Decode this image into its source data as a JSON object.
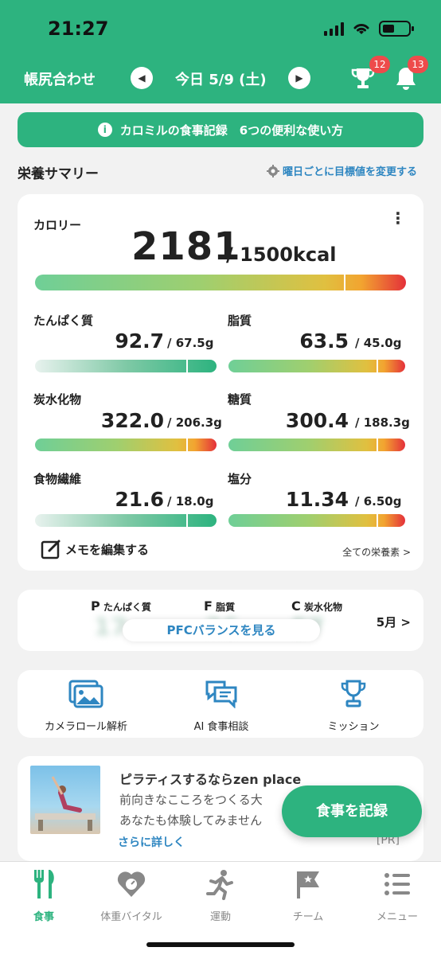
{
  "status": {
    "time": "21:27"
  },
  "header": {
    "left_label": "帳尻合わせ",
    "date": "今日 5/9 (土)",
    "trophy_badge": "12",
    "bell_badge": "13"
  },
  "banner": {
    "text": "カロミルの食事記録　6つの便利な使い方"
  },
  "summary": {
    "title": "栄養サマリー",
    "link": "曜日ごとに目標値を変更する"
  },
  "calories": {
    "label": "カロリー",
    "value": "2181",
    "target": "/ 1500kcal",
    "progress": 1.454
  },
  "nutrients": [
    {
      "name": "たんぱく質",
      "value": "92.7",
      "target": "/ 67.5g",
      "progress": 1.37
    },
    {
      "name": "脂質",
      "value": "63.5",
      "target": "/ 45.0g",
      "progress": 1.41
    },
    {
      "name": "炭水化物",
      "value": "322.0",
      "target": "/ 206.3g",
      "progress": 1.56
    },
    {
      "name": "糖質",
      "value": "300.4",
      "target": "/ 188.3g",
      "progress": 1.6
    },
    {
      "name": "食物繊維",
      "value": "21.6",
      "target": "/ 18.0g",
      "progress": 1.2
    },
    {
      "name": "塩分",
      "value": "11.34",
      "target": "/ 6.50g",
      "progress": 1.74
    }
  ],
  "memo": {
    "label": "メモを編集する",
    "all": "全ての栄養素 >"
  },
  "pfc": {
    "p": "P",
    "p_label": "たんぱく質",
    "f": "F",
    "f_label": "脂質",
    "c": "C",
    "c_label": "炭水化物",
    "button": "PFCバランスを見る",
    "month": "5月 >"
  },
  "tools": [
    {
      "label": "カメラロール解析",
      "icon": "image-icon"
    },
    {
      "label": "AI 食事相談",
      "icon": "chat-icon"
    },
    {
      "label": "ミッション",
      "icon": "trophy-icon"
    }
  ],
  "ad": {
    "title": "ピラティスするならzen place",
    "line1": "前向きなこころをつくる大",
    "line2": "あなたも体験してみません",
    "more": "さらに詳しく",
    "pr": "[PR]"
  },
  "fab": {
    "label": "食事を記録"
  },
  "tabs": [
    {
      "label": "食事",
      "icon": "fork-knife-icon",
      "active": true
    },
    {
      "label": "体重バイタル",
      "icon": "heart-scale-icon"
    },
    {
      "label": "運動",
      "icon": "running-icon"
    },
    {
      "label": "チーム",
      "icon": "flag-icon"
    },
    {
      "label": "メニュー",
      "icon": "list-icon"
    }
  ],
  "colors": {
    "brand": "#2db37f",
    "link": "#2e86c1",
    "badge": "#ee4b4b"
  }
}
